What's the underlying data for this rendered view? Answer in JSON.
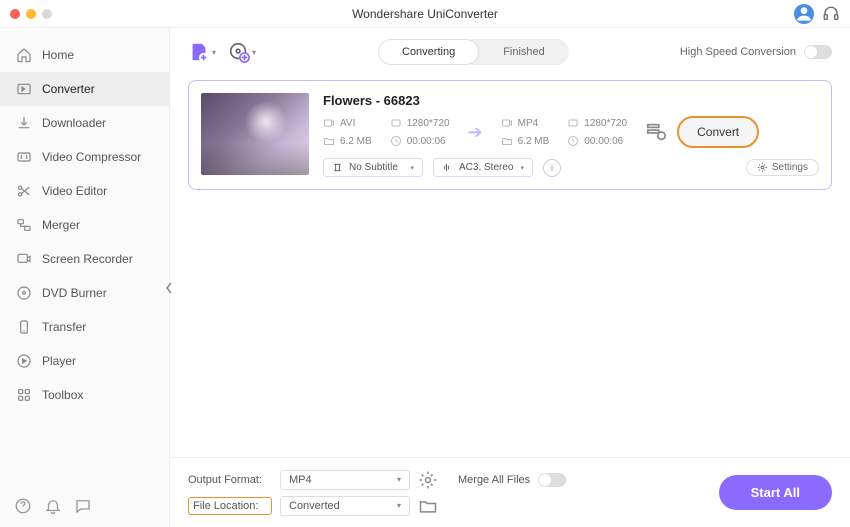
{
  "app": {
    "title": "Wondershare UniConverter"
  },
  "sidebar": {
    "items": [
      {
        "label": "Home",
        "icon": "home"
      },
      {
        "label": "Converter",
        "icon": "converter"
      },
      {
        "label": "Downloader",
        "icon": "downloader"
      },
      {
        "label": "Video Compressor",
        "icon": "compressor"
      },
      {
        "label": "Video Editor",
        "icon": "editor"
      },
      {
        "label": "Merger",
        "icon": "merger"
      },
      {
        "label": "Screen Recorder",
        "icon": "recorder"
      },
      {
        "label": "DVD Burner",
        "icon": "dvd"
      },
      {
        "label": "Transfer",
        "icon": "transfer"
      },
      {
        "label": "Player",
        "icon": "player"
      },
      {
        "label": "Toolbox",
        "icon": "toolbox"
      }
    ],
    "active_index": 1
  },
  "tabs": {
    "converting": "Converting",
    "finished": "Finished",
    "active": "converting"
  },
  "hsc_label": "High Speed Conversion",
  "file": {
    "title": "Flowers - 66823",
    "source": {
      "format": "AVI",
      "resolution": "1280*720",
      "size": "6.2 MB",
      "duration": "00:00:06"
    },
    "target": {
      "format": "MP4",
      "resolution": "1280*720",
      "size": "6.2 MB",
      "duration": "00:00:06"
    },
    "subtitle": "No Subtitle",
    "audio": "AC3, Stereo",
    "settings_label": "Settings",
    "convert_label": "Convert"
  },
  "footer": {
    "output_format_label": "Output Format:",
    "output_format_value": "MP4",
    "file_location_label": "File Location:",
    "file_location_value": "Converted",
    "merge_label": "Merge All Files",
    "start_all": "Start All"
  }
}
